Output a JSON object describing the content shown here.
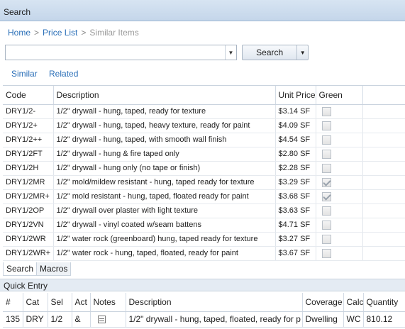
{
  "window": {
    "title": "Search"
  },
  "breadcrumb": {
    "home": "Home",
    "price_list": "Price List",
    "current": "Similar Items",
    "separator": ">"
  },
  "search": {
    "value": "",
    "placeholder": "",
    "button_label": "Search"
  },
  "view_tabs": [
    "Similar",
    "Related"
  ],
  "grid": {
    "columns": [
      "Code",
      "Description",
      "Unit Price",
      "Green"
    ],
    "rows": [
      {
        "code": "DRY1/2-",
        "description": "1/2\" drywall - hung, taped, ready for texture",
        "price": "$3.14 SF",
        "green": false
      },
      {
        "code": "DRY1/2+",
        "description": "1/2\" drywall - hung, taped, heavy texture, ready for paint",
        "price": "$4.09 SF",
        "green": false
      },
      {
        "code": "DRY1/2++",
        "description": "1/2\" drywall - hung, taped, with smooth wall finish",
        "price": "$4.54 SF",
        "green": false
      },
      {
        "code": "DRY1/2FT",
        "description": "1/2\" drywall - hung & fire taped only",
        "price": "$2.80 SF",
        "green": false
      },
      {
        "code": "DRY1/2H",
        "description": "1/2\" drywall - hung only (no tape or finish)",
        "price": "$2.28 SF",
        "green": false
      },
      {
        "code": "DRY1/2MR",
        "description": "1/2\" mold/mildew resistant - hung, taped ready for texture",
        "price": "$3.29 SF",
        "green": true
      },
      {
        "code": "DRY1/2MR+",
        "description": "1/2\" mold resistant - hung, taped, floated ready for paint",
        "price": "$3.68 SF",
        "green": true
      },
      {
        "code": "DRY1/2OP",
        "description": "1/2\" drywall over plaster with light texture",
        "price": "$3.63 SF",
        "green": false
      },
      {
        "code": "DRY1/2VN",
        "description": "1/2\" drywall - vinyl coated w/seam battens",
        "price": "$4.71 SF",
        "green": false
      },
      {
        "code": "DRY1/2WR",
        "description": "1/2\" water rock (greenboard) hung, taped ready for texture",
        "price": "$3.27 SF",
        "green": false
      },
      {
        "code": "DRY1/2WR+",
        "description": "1/2\" water rock - hung, taped, floated, ready for paint",
        "price": "$3.67 SF",
        "green": false
      }
    ]
  },
  "bottom_tabs": [
    "Search",
    "Macros"
  ],
  "quick_entry": {
    "title": "Quick Entry",
    "columns": [
      "#",
      "Cat",
      "Sel",
      "Act",
      "Notes",
      "Description",
      "Coverage",
      "Calc",
      "Quantity"
    ],
    "row": {
      "num": "135",
      "cat": "DRY",
      "sel": "1/2",
      "act": "&",
      "description": "1/2\" drywall - hung, taped, floated, ready for p",
      "coverage": "Dwelling",
      "calc": "WC",
      "quantity": "810.12"
    }
  }
}
